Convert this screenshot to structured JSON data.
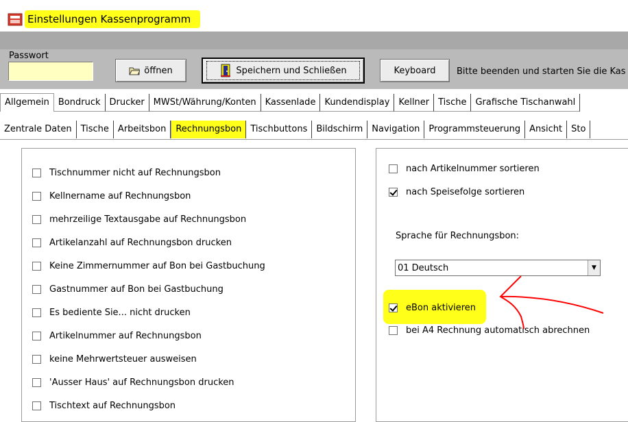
{
  "window": {
    "title": "Einstellungen Kassenprogramm"
  },
  "toolbar": {
    "password_label": "Passwort",
    "password_value": "",
    "open_label": "öffnen",
    "save_label": "Speichern und Schließen",
    "keyboard_label": "Keyboard",
    "info_text": "Bitte beenden und starten Sie die Kas"
  },
  "tabs_primary": [
    "Allgemein",
    "Bondruck",
    "Drucker",
    "MWSt/Währung/Konten",
    "Kassenlade",
    "Kundendisplay",
    "Kellner",
    "Tische",
    "Grafische Tischanwahl"
  ],
  "tabs_secondary": [
    "Zentrale Daten",
    "Tische",
    "Arbeitsbon",
    "Rechnungsbon",
    "Tischbuttons",
    "Bildschirm",
    "Navigation",
    "Programmsteuerung",
    "Ansicht",
    "Sto"
  ],
  "active_primary": "Allgemein",
  "active_secondary": "Rechnungsbon",
  "left_options": [
    {
      "label": "Tischnummer nicht auf Rechnungsbon",
      "checked": false
    },
    {
      "label": "Kellnername auf Rechnungsbon",
      "checked": false
    },
    {
      "label": "mehrzeilige Textausgabe auf Rechnungsbon",
      "checked": false
    },
    {
      "label": "Artikelanzahl auf Rechnungsbon drucken",
      "checked": false
    },
    {
      "label": "Keine Zimmernummer auf Bon bei Gastbuchung",
      "checked": false
    },
    {
      "label": "Gastnummer auf Bon bei Gastbuchung",
      "checked": false
    },
    {
      "label": "Es bediente Sie... nicht drucken",
      "checked": false
    },
    {
      "label": "Artikelnummer auf Rechnungsbon",
      "checked": false
    },
    {
      "label": "keine Mehrwertsteuer ausweisen",
      "checked": false
    },
    {
      "label": "'Ausser Haus' auf Rechnungsbon drucken",
      "checked": false
    },
    {
      "label": "Tischtext auf Rechnungsbon",
      "checked": false
    }
  ],
  "right_options": {
    "sort_by_article_number": {
      "label": "nach Artikelnummer sortieren",
      "checked": false
    },
    "sort_by_course": {
      "label": "nach Speisefolge sortieren",
      "checked": true
    },
    "language_label": "Sprache für Rechnungsbon:",
    "language_value": "01 Deutsch",
    "ebon": {
      "label": "eBon aktivieren",
      "checked": true
    },
    "a4_auto": {
      "label": "bei A4 Rechnung automatisch abrechnen",
      "checked": false
    }
  },
  "colors": {
    "highlight": "#ffff1a",
    "annotation": "#ff0000",
    "toolbar_bg": "#bababa"
  }
}
